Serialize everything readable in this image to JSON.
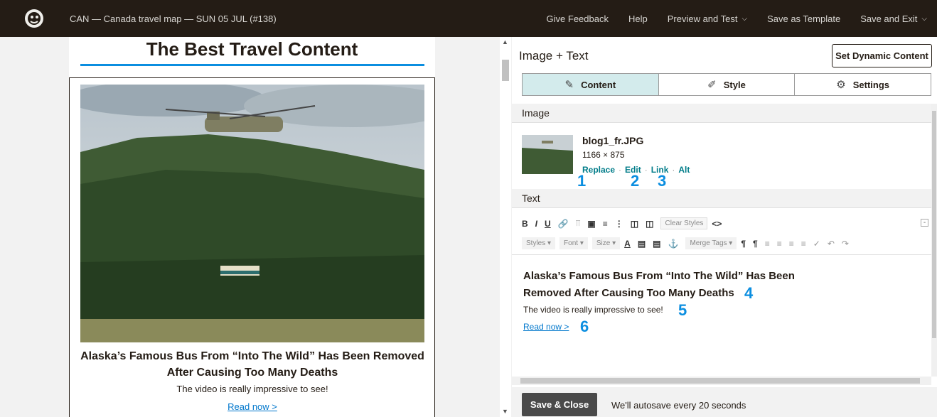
{
  "topbar": {
    "campaign_title": "CAN — Canada travel map — SUN 05 JUL (#138)",
    "nav": [
      {
        "label": "Give Feedback",
        "dropdown": false
      },
      {
        "label": "Help",
        "dropdown": false
      },
      {
        "label": "Preview and Test",
        "dropdown": true
      },
      {
        "label": "Save as Template",
        "dropdown": false
      },
      {
        "label": "Save and Exit",
        "dropdown": true
      }
    ]
  },
  "preview": {
    "heading": "The Best Travel Content",
    "block_title": "Alaska’s Famous Bus From “Into The Wild” Has Been Removed After Causing Too Many Deaths",
    "block_desc": "The video is really impressive to see!",
    "block_link": "Read now >"
  },
  "editor": {
    "title": "Image + Text",
    "dynamic_button": "Set Dynamic Content",
    "tabs": [
      {
        "label": "Content",
        "icon": "edit-icon",
        "active": true
      },
      {
        "label": "Style",
        "icon": "brush-icon",
        "active": false
      },
      {
        "label": "Settings",
        "icon": "gear-icon",
        "active": false
      }
    ],
    "image_section": {
      "header": "Image",
      "file_name": "blog1_fr.JPG",
      "dimensions": "1166 × 875",
      "actions": [
        "Replace",
        "Edit",
        "Link",
        "Alt"
      ]
    },
    "text_section": {
      "header": "Text",
      "toolbar1": {
        "clear_styles": "Clear Styles"
      },
      "toolbar2": {
        "styles": "Styles",
        "font": "Font",
        "size": "Size",
        "merge_tags": "Merge Tags"
      },
      "content_title": "Alaska’s Famous Bus From “Into The Wild” Has Been Removed After Causing Too Many Deaths",
      "content_desc": "The video is really impressive to see!",
      "content_link": "Read now >"
    },
    "annotations": [
      "1",
      "2",
      "3",
      "4",
      "5",
      "6"
    ],
    "footer": {
      "save_button": "Save & Close",
      "autosave_note": "We'll autosave every 20 seconds"
    }
  },
  "colors": {
    "topbar_bg": "#241c15",
    "accent_blue": "#0b8ee0",
    "link_teal": "#007c89",
    "active_tab": "#d3ebec"
  }
}
